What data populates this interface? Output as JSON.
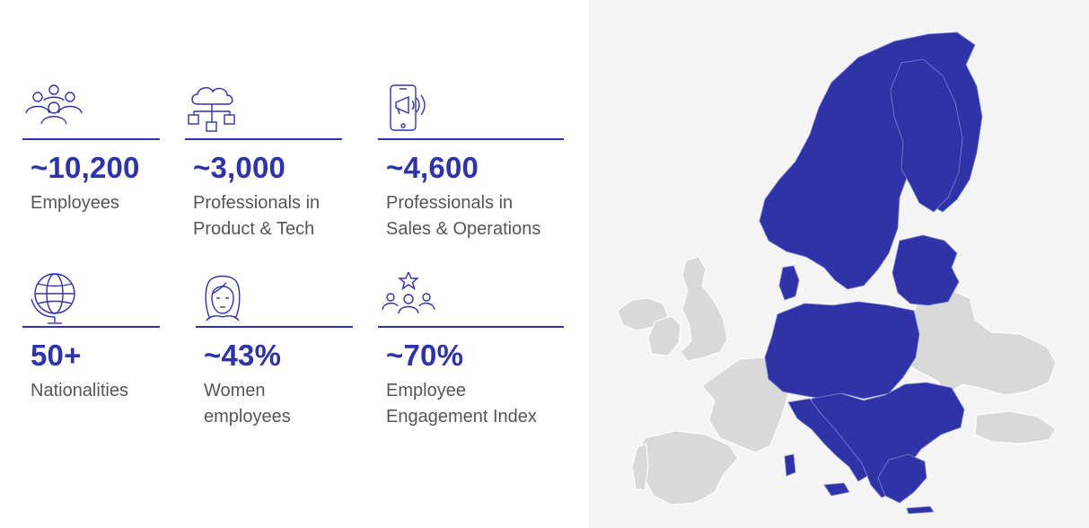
{
  "colors": {
    "accent": "#2f33a8",
    "label_text": "#555555",
    "map_background": "#f4f4f4",
    "map_highlight": "#2f33a8",
    "map_other": "#d9d9d9"
  },
  "stats": [
    {
      "icon": "people-group-icon",
      "value": "~10,200",
      "label_line1": "Employees",
      "label_line2": ""
    },
    {
      "icon": "cloud-network-icon",
      "value": "~3,000",
      "label_line1": "Professionals in",
      "label_line2": "Product & Tech"
    },
    {
      "icon": "phone-megaphone-icon",
      "value": "~4,600",
      "label_line1": "Professionals in",
      "label_line2": "Sales & Operations"
    },
    {
      "icon": "globe-icon",
      "value": "50+",
      "label_line1": "Nationalities",
      "label_line2": ""
    },
    {
      "icon": "woman-face-icon",
      "value": "~43%",
      "label_line1": "Women",
      "label_line2": "employees"
    },
    {
      "icon": "team-star-icon",
      "value": "~70%",
      "label_line1": "Employee",
      "label_line2": "Engagement Index"
    }
  ]
}
